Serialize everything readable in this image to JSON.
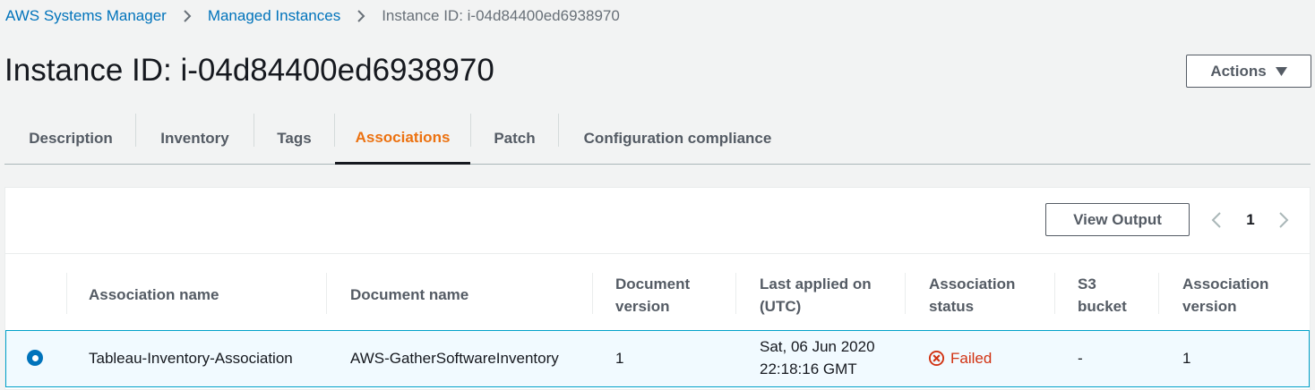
{
  "breadcrumb": {
    "items": [
      "AWS Systems Manager",
      "Managed Instances",
      "Instance ID: i-04d84400ed6938970"
    ]
  },
  "page": {
    "title": "Instance ID: i-04d84400ed6938970",
    "actions_label": "Actions"
  },
  "tabs": [
    {
      "label": "Description"
    },
    {
      "label": "Inventory"
    },
    {
      "label": "Tags"
    },
    {
      "label": "Associations"
    },
    {
      "label": "Patch"
    },
    {
      "label": "Configuration compliance"
    }
  ],
  "active_tab": "Associations",
  "panel": {
    "view_output_label": "View Output",
    "page_number": "1"
  },
  "table": {
    "columns": [
      {
        "line1": "Association name",
        "line2": ""
      },
      {
        "line1": "Document name",
        "line2": ""
      },
      {
        "line1": "Document",
        "line2": "version"
      },
      {
        "line1": "Last applied on",
        "line2": "(UTC)"
      },
      {
        "line1": "Association",
        "line2": "status"
      },
      {
        "line1": "S3",
        "line2": "bucket"
      },
      {
        "line1": "Association",
        "line2": "version"
      }
    ],
    "rows": [
      {
        "association_name": "Tableau-Inventory-Association",
        "document_name": "AWS-GatherSoftwareInventory",
        "document_version": "1",
        "last_applied_line1": "Sat, 06 Jun 2020",
        "last_applied_line2": "22:18:16 GMT",
        "status": "Failed",
        "s3_bucket": "-",
        "association_version": "1"
      }
    ]
  },
  "colors": {
    "link": "#0073bb",
    "active_tab": "#ec7211",
    "failed": "#d13212",
    "selected_row_border": "#00a1c9"
  },
  "icons": [
    "chevron-right-icon",
    "caret-down-icon",
    "chevron-left-icon",
    "error-circle-icon"
  ]
}
